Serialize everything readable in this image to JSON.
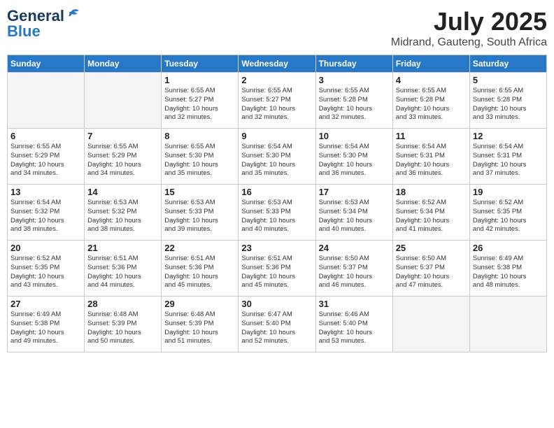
{
  "logo": {
    "general": "General",
    "blue": "Blue"
  },
  "title": "July 2025",
  "location": "Midrand, Gauteng, South Africa",
  "days_header": [
    "Sunday",
    "Monday",
    "Tuesday",
    "Wednesday",
    "Thursday",
    "Friday",
    "Saturday"
  ],
  "weeks": [
    [
      {
        "num": "",
        "empty": true
      },
      {
        "num": "",
        "empty": true
      },
      {
        "num": "1",
        "sunrise": "6:55 AM",
        "sunset": "5:27 PM",
        "daylight": "10 hours and 32 minutes."
      },
      {
        "num": "2",
        "sunrise": "6:55 AM",
        "sunset": "5:27 PM",
        "daylight": "10 hours and 32 minutes."
      },
      {
        "num": "3",
        "sunrise": "6:55 AM",
        "sunset": "5:28 PM",
        "daylight": "10 hours and 32 minutes."
      },
      {
        "num": "4",
        "sunrise": "6:55 AM",
        "sunset": "5:28 PM",
        "daylight": "10 hours and 33 minutes."
      },
      {
        "num": "5",
        "sunrise": "6:55 AM",
        "sunset": "5:28 PM",
        "daylight": "10 hours and 33 minutes."
      }
    ],
    [
      {
        "num": "6",
        "sunrise": "6:55 AM",
        "sunset": "5:29 PM",
        "daylight": "10 hours and 34 minutes."
      },
      {
        "num": "7",
        "sunrise": "6:55 AM",
        "sunset": "5:29 PM",
        "daylight": "10 hours and 34 minutes."
      },
      {
        "num": "8",
        "sunrise": "6:55 AM",
        "sunset": "5:30 PM",
        "daylight": "10 hours and 35 minutes."
      },
      {
        "num": "9",
        "sunrise": "6:54 AM",
        "sunset": "5:30 PM",
        "daylight": "10 hours and 35 minutes."
      },
      {
        "num": "10",
        "sunrise": "6:54 AM",
        "sunset": "5:30 PM",
        "daylight": "10 hours and 36 minutes."
      },
      {
        "num": "11",
        "sunrise": "6:54 AM",
        "sunset": "5:31 PM",
        "daylight": "10 hours and 36 minutes."
      },
      {
        "num": "12",
        "sunrise": "6:54 AM",
        "sunset": "5:31 PM",
        "daylight": "10 hours and 37 minutes."
      }
    ],
    [
      {
        "num": "13",
        "sunrise": "6:54 AM",
        "sunset": "5:32 PM",
        "daylight": "10 hours and 38 minutes."
      },
      {
        "num": "14",
        "sunrise": "6:53 AM",
        "sunset": "5:32 PM",
        "daylight": "10 hours and 38 minutes."
      },
      {
        "num": "15",
        "sunrise": "6:53 AM",
        "sunset": "5:33 PM",
        "daylight": "10 hours and 39 minutes."
      },
      {
        "num": "16",
        "sunrise": "6:53 AM",
        "sunset": "5:33 PM",
        "daylight": "10 hours and 40 minutes."
      },
      {
        "num": "17",
        "sunrise": "6:53 AM",
        "sunset": "5:34 PM",
        "daylight": "10 hours and 40 minutes."
      },
      {
        "num": "18",
        "sunrise": "6:52 AM",
        "sunset": "5:34 PM",
        "daylight": "10 hours and 41 minutes."
      },
      {
        "num": "19",
        "sunrise": "6:52 AM",
        "sunset": "5:35 PM",
        "daylight": "10 hours and 42 minutes."
      }
    ],
    [
      {
        "num": "20",
        "sunrise": "6:52 AM",
        "sunset": "5:35 PM",
        "daylight": "10 hours and 43 minutes."
      },
      {
        "num": "21",
        "sunrise": "6:51 AM",
        "sunset": "5:36 PM",
        "daylight": "10 hours and 44 minutes."
      },
      {
        "num": "22",
        "sunrise": "6:51 AM",
        "sunset": "5:36 PM",
        "daylight": "10 hours and 45 minutes."
      },
      {
        "num": "23",
        "sunrise": "6:51 AM",
        "sunset": "5:36 PM",
        "daylight": "10 hours and 45 minutes."
      },
      {
        "num": "24",
        "sunrise": "6:50 AM",
        "sunset": "5:37 PM",
        "daylight": "10 hours and 46 minutes."
      },
      {
        "num": "25",
        "sunrise": "6:50 AM",
        "sunset": "5:37 PM",
        "daylight": "10 hours and 47 minutes."
      },
      {
        "num": "26",
        "sunrise": "6:49 AM",
        "sunset": "5:38 PM",
        "daylight": "10 hours and 48 minutes."
      }
    ],
    [
      {
        "num": "27",
        "sunrise": "6:49 AM",
        "sunset": "5:38 PM",
        "daylight": "10 hours and 49 minutes."
      },
      {
        "num": "28",
        "sunrise": "6:48 AM",
        "sunset": "5:39 PM",
        "daylight": "10 hours and 50 minutes."
      },
      {
        "num": "29",
        "sunrise": "6:48 AM",
        "sunset": "5:39 PM",
        "daylight": "10 hours and 51 minutes."
      },
      {
        "num": "30",
        "sunrise": "6:47 AM",
        "sunset": "5:40 PM",
        "daylight": "10 hours and 52 minutes."
      },
      {
        "num": "31",
        "sunrise": "6:46 AM",
        "sunset": "5:40 PM",
        "daylight": "10 hours and 53 minutes."
      },
      {
        "num": "",
        "empty": true
      },
      {
        "num": "",
        "empty": true
      }
    ]
  ],
  "labels": {
    "sunrise": "Sunrise:",
    "sunset": "Sunset:",
    "daylight": "Daylight:"
  }
}
